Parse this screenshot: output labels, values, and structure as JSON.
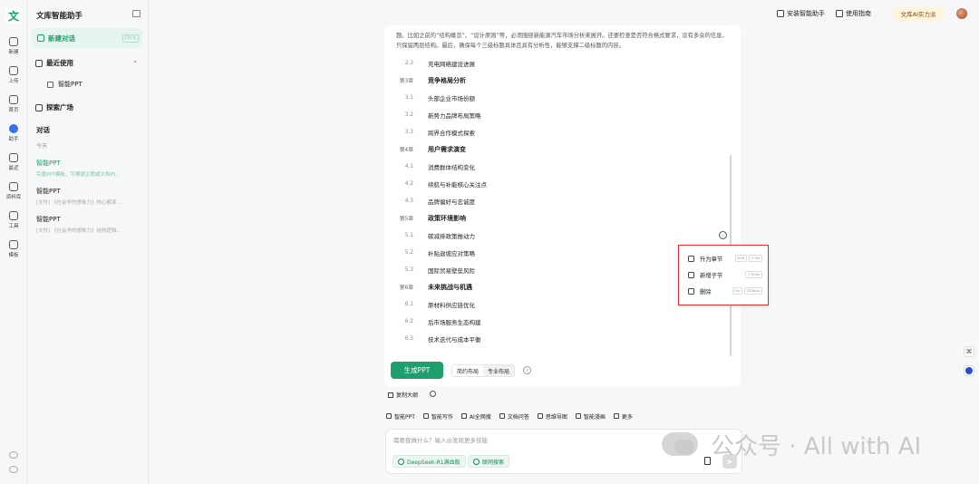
{
  "rail": {
    "logo": "文",
    "items": [
      {
        "label": "新建",
        "icon": "plus-icon"
      },
      {
        "label": "上传",
        "icon": "upload-icon"
      },
      {
        "label": "首页",
        "icon": "home-icon"
      },
      {
        "label": "助手",
        "icon": "assistant-icon"
      },
      {
        "label": "最近",
        "icon": "clock-icon"
      },
      {
        "label": "资料库",
        "icon": "folder-icon"
      },
      {
        "label": "工具",
        "icon": "toolbox-icon"
      },
      {
        "label": "模板",
        "icon": "palette-icon"
      }
    ]
  },
  "sidebar": {
    "title": "文库智能助手",
    "new_chat": "新建对话",
    "new_chat_shortcut": "Ctrl K",
    "recent": "最近使用",
    "recent_item": "智能PPT",
    "explore": "探索广场",
    "conversations_heading": "对话",
    "today": "今天",
    "conversations": [
      {
        "title": "智能PPT",
        "desc": "完善PPT模板，可根据主题或文档内..."
      },
      {
        "title": "智能PPT",
        "desc": "[文件] 《社会学的想象力》核心解读..."
      },
      {
        "title": "智能PPT",
        "desc": "[文件] 《社会学的想象力》结构逻辑..."
      }
    ]
  },
  "topbar": {
    "install": "安装智能助手",
    "guide": "使用指南",
    "pro": "文库AI实力派"
  },
  "card": {
    "intro": "题。比如之前的“结构概览”、“设计原则”等，必须围绕新能源汽车市场分析来展开。还要检查是否符合格式要求，没有多余的信息，只保留两层结构。最后，确保每个三级标题具体且具有分析性，能够支撑二级标题的内容。",
    "outline": [
      {
        "num": "2.3",
        "text": "充电网络建设进展",
        "chapter": false
      },
      {
        "num": "第3章",
        "text": "竞争格局分析",
        "chapter": true
      },
      {
        "num": "3.1",
        "text": "头部企业市场份额",
        "chapter": false
      },
      {
        "num": "3.2",
        "text": "新势力品牌布局策略",
        "chapter": false
      },
      {
        "num": "3.3",
        "text": "跨界合作模式探索",
        "chapter": false
      },
      {
        "num": "第4章",
        "text": "用户需求演变",
        "chapter": true
      },
      {
        "num": "4.1",
        "text": "消费群体结构变化",
        "chapter": false
      },
      {
        "num": "4.2",
        "text": "续航与补能核心关注点",
        "chapter": false
      },
      {
        "num": "4.3",
        "text": "品牌偏好与忠诚度",
        "chapter": false
      },
      {
        "num": "第5章",
        "text": "政策环境影响",
        "chapter": true
      },
      {
        "num": "5.1",
        "text": "碳减排政策推动力",
        "chapter": false
      },
      {
        "num": "5.2",
        "text": "补贴退坡应对策略",
        "chapter": false
      },
      {
        "num": "5.3",
        "text": "国际贸易壁垒风险",
        "chapter": false
      },
      {
        "num": "第6章",
        "text": "未来挑战与机遇",
        "chapter": true
      },
      {
        "num": "6.1",
        "text": "原材料供应链优化",
        "chapter": false
      },
      {
        "num": "6.2",
        "text": "后市场服务生态构建",
        "chapter": false
      },
      {
        "num": "6.3",
        "text": "技术迭代与成本平衡",
        "chapter": false
      }
    ],
    "more_glyph": "···",
    "generate": "生成PPT",
    "layout_simple": "简约布局",
    "layout_pro": "专业布局",
    "info_glyph": "i"
  },
  "context_menu": [
    {
      "label": "升为章节",
      "icon": "promote-icon",
      "keys": [
        "Shift",
        "⇥ Tab"
      ]
    },
    {
      "label": "新增子节",
      "icon": "add-circle-icon",
      "keys": [
        "⏎ Enter"
      ]
    },
    {
      "label": "删除",
      "icon": "trash-icon",
      "keys": [
        "Ctrl",
        "⌫ Back"
      ]
    }
  ],
  "below": {
    "copy": "复制大纲",
    "tools": [
      "智能PPT",
      "智能写作",
      "AI全网搜",
      "文档问答",
      "思维导图",
      "智能漫画",
      "更多"
    ]
  },
  "input": {
    "placeholder": "需要我做什么？输入@发现更多技能",
    "chip_deepseek": "DeepSeek-R1满血版",
    "chip_web": "联网搜索",
    "send_glyph": "➤"
  },
  "float_a_glyph": "⌘",
  "watermark": {
    "text": "公众号 · All with AI"
  }
}
